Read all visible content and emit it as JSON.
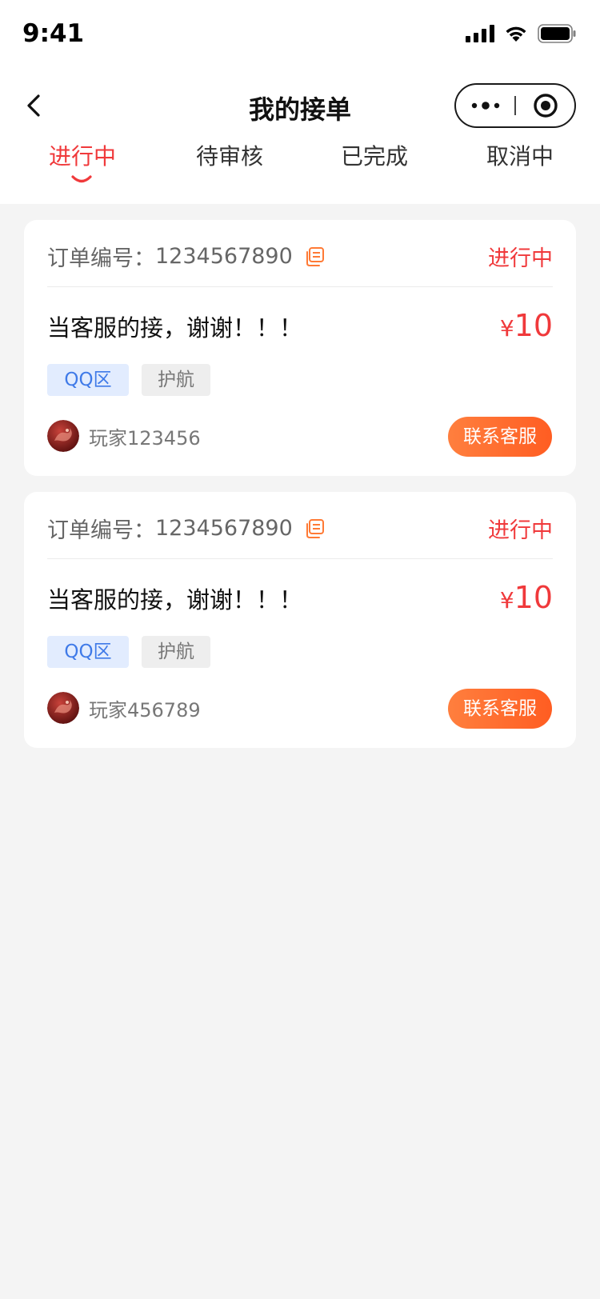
{
  "status_bar": {
    "time": "9:41"
  },
  "nav": {
    "title": "我的接单"
  },
  "tabs": [
    {
      "label": "进行中",
      "active": true
    },
    {
      "label": "待审核",
      "active": false
    },
    {
      "label": "已完成",
      "active": false
    },
    {
      "label": "取消中",
      "active": false
    }
  ],
  "colors": {
    "accent": "#f0393b",
    "button": "#ff6a2b",
    "tag_blue": "#3f7ae8",
    "background": "#f4f4f4"
  },
  "orders": [
    {
      "order_label": "订单编号：",
      "order_no": "1234567890",
      "status": "进行中",
      "title": "当客服的接，谢谢！！！",
      "price_symbol": "¥",
      "price": "10",
      "tags": [
        "QQ区",
        "护航"
      ],
      "player": "玩家123456",
      "contact_label": "联系客服"
    },
    {
      "order_label": "订单编号：",
      "order_no": "1234567890",
      "status": "进行中",
      "title": "当客服的接，谢谢！！！",
      "price_symbol": "¥",
      "price": "10",
      "tags": [
        "QQ区",
        "护航"
      ],
      "player": "玩家456789",
      "contact_label": "联系客服"
    }
  ]
}
